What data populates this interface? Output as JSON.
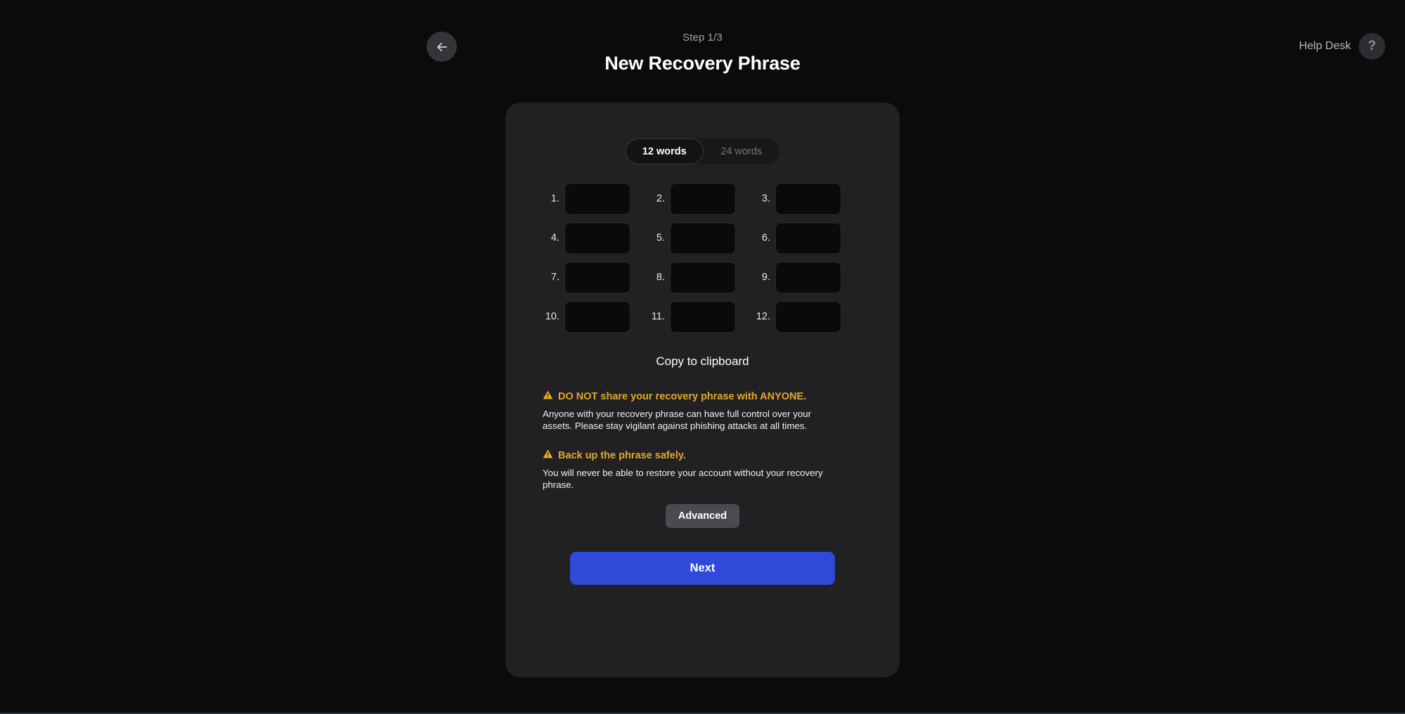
{
  "header": {
    "back_icon": "arrow-left-icon",
    "step_label": "Step 1/3",
    "title": "New Recovery Phrase",
    "help_label": "Help Desk",
    "help_icon": "question-mark-icon"
  },
  "word_count_toggle": {
    "options": [
      {
        "label": "12 words",
        "selected": true
      },
      {
        "label": "24 words",
        "selected": false
      }
    ]
  },
  "word_grid": {
    "placeholder": "",
    "entries": [
      {
        "index": "1.",
        "value": ""
      },
      {
        "index": "2.",
        "value": ""
      },
      {
        "index": "3.",
        "value": ""
      },
      {
        "index": "4.",
        "value": ""
      },
      {
        "index": "5.",
        "value": ""
      },
      {
        "index": "6.",
        "value": ""
      },
      {
        "index": "7.",
        "value": ""
      },
      {
        "index": "8.",
        "value": ""
      },
      {
        "index": "9.",
        "value": ""
      },
      {
        "index": "10.",
        "value": ""
      },
      {
        "index": "11.",
        "value": ""
      },
      {
        "index": "12.",
        "value": ""
      }
    ]
  },
  "copy_link": "Copy to clipboard",
  "warnings": [
    {
      "icon": "warning-triangle-icon",
      "heading": "DO NOT share your recovery phrase with ANYONE.",
      "body": "Anyone with your recovery phrase can have full control over your assets. Please stay vigilant against phishing attacks at all times."
    },
    {
      "icon": "warning-triangle-icon",
      "heading": "Back up the phrase safely.",
      "body": "You will never be able to restore your account without your recovery phrase."
    }
  ],
  "buttons": {
    "advanced": "Advanced",
    "next": "Next"
  },
  "colors": {
    "page_background": "#0b0b0c",
    "card_background": "#212124",
    "word_box_background": "#0a0a0b",
    "accent_primary": "#2f49d8",
    "warning_amber": "#e2a82a",
    "advanced_button": "#4a4b50",
    "muted_text": "#a3a4a8"
  }
}
